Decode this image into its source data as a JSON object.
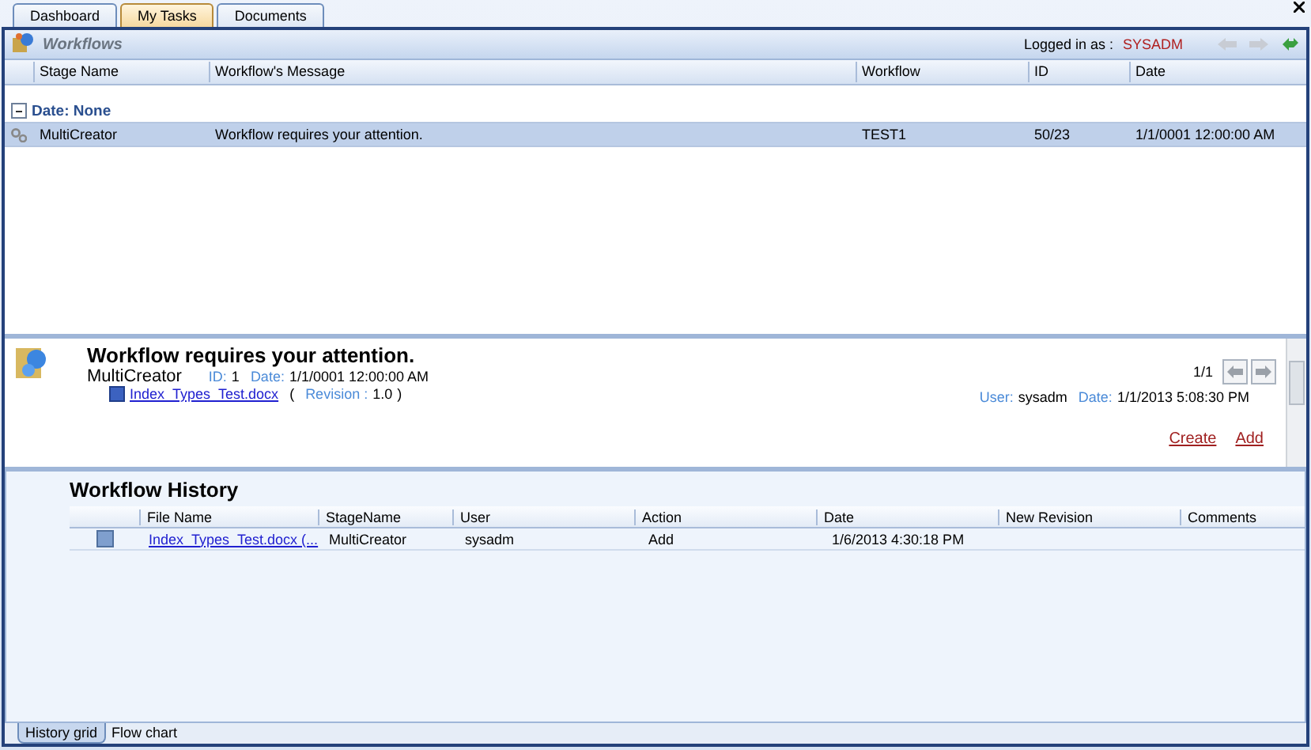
{
  "tabs": [
    {
      "label": "Dashboard",
      "selected": false
    },
    {
      "label": "My Tasks",
      "selected": true
    },
    {
      "label": "Documents",
      "selected": false
    }
  ],
  "workflows": {
    "title": "Workflows",
    "logged_in_label": "Logged in as :",
    "logged_in_user": "SYSADM",
    "columns": [
      "Stage Name",
      "Workflow's Message",
      "Workflow",
      "ID",
      "Date"
    ],
    "group": "Date: None",
    "rows": [
      {
        "stage": "MultiCreator",
        "message": "Workflow requires your attention.",
        "workflow": "TEST1",
        "id": "50/23",
        "date": "1/1/0001 12:00:00 AM",
        "selected": true
      }
    ]
  },
  "detail": {
    "title": "Workflow requires your attention.",
    "stage": "MultiCreator",
    "id_label": "ID:",
    "id": "1",
    "date_label": "Date:",
    "date": "1/1/0001 12:00:00 AM",
    "file": "Index_Types_Test.docx",
    "revision_open": "(",
    "revision_label": "Revision :",
    "revision": "1.0",
    "revision_close": ")",
    "pager": "1/1",
    "user_label": "User:",
    "user": "sysadm",
    "user_date_label": "Date:",
    "user_date": "1/1/2013 5:08:30 PM",
    "links": [
      "Create",
      "Add"
    ]
  },
  "history": {
    "title": "Workflow History",
    "columns": [
      "File Name",
      "StageName",
      "User",
      "Action",
      "Date",
      "New Revision",
      "Comments"
    ],
    "rows": [
      {
        "file": "Index_Types_Test.docx (...",
        "stage": "MultiCreator",
        "user": "sysadm",
        "action": "Add",
        "date": "1/6/2013 4:30:18 PM"
      }
    ]
  },
  "bottom_tabs": [
    {
      "label": "History grid",
      "selected": true
    },
    {
      "label": "Flow chart",
      "selected": false
    }
  ]
}
